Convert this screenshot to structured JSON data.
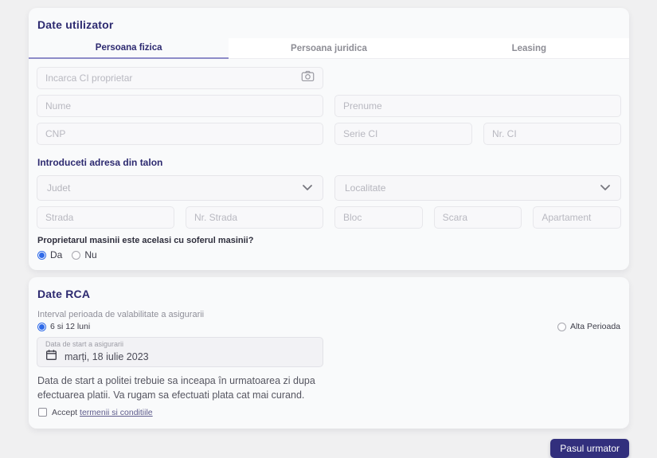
{
  "user_card": {
    "title": "Date utilizator",
    "tabs": [
      {
        "label": "Persoana fizica",
        "active": true
      },
      {
        "label": "Persoana juridica",
        "active": false
      },
      {
        "label": "Leasing",
        "active": false
      }
    ],
    "upload": {
      "placeholder": "Incarca CI proprietar",
      "icon": "camera-icon"
    },
    "fields": {
      "nume": "Nume",
      "prenume": "Prenume",
      "cnp": "CNP",
      "serie_ci": "Serie CI",
      "nr_ci": "Nr. CI"
    },
    "address": {
      "heading": "Introduceti adresa din talon",
      "judet": "Judet",
      "localitate": "Localitate",
      "strada": "Strada",
      "nr_strada": "Nr. Strada",
      "bloc": "Bloc",
      "scara": "Scara",
      "apartament": "Apartament"
    },
    "owner_question": {
      "label": "Proprietarul masinii este acelasi cu soferul masinii?",
      "options": [
        {
          "label": "Da",
          "selected": true
        },
        {
          "label": "Nu",
          "selected": false
        }
      ]
    }
  },
  "rca_card": {
    "title": "Date RCA",
    "interval_label": "Interval perioada de valabilitate a asigurarii",
    "interval_options": [
      {
        "label": "6 si 12 luni",
        "selected": true
      },
      {
        "label": "Alta Perioada",
        "selected": false
      }
    ],
    "start_date": {
      "label": "Data de start a asigurarii",
      "value": "marți, 18 iulie 2023",
      "icon": "calendar-icon"
    },
    "note": "Data de start a politei trebuie sa inceapa în urmatoarea zi dupa efectuarea platii. Va rugam sa efectuati plata cat mai curand.",
    "terms": {
      "prefix": "Accept",
      "link": "termenii si conditiile",
      "checked": false
    }
  },
  "footer": {
    "next_button": "Pasul urmator"
  },
  "colors": {
    "accent_navy": "#2d2a70",
    "radio_blue": "#2f6ae8",
    "button_bg": "#322f7d",
    "tab_underline": "#8e8cc8",
    "page_bg": "#f0f0f1",
    "card_bg": "#f9fafb"
  }
}
